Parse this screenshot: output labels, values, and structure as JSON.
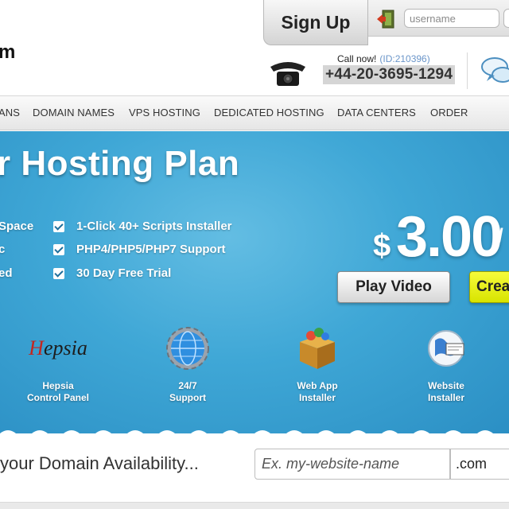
{
  "header": {
    "logo_fragment": "m",
    "signup_label": "Sign Up",
    "username_placeholder": "username",
    "call_now_label": "Call now!",
    "call_id": "(ID:210396)",
    "phone_number": "+44-20-3695-1294"
  },
  "nav": {
    "items": [
      {
        "label": "ANS"
      },
      {
        "label": "DOMAIN NAMES"
      },
      {
        "label": "VPS HOSTING"
      },
      {
        "label": "DEDICATED HOSTING"
      },
      {
        "label": "DATA CENTERS"
      },
      {
        "label": "ORDER"
      }
    ]
  },
  "hero": {
    "title": "r Hosting Plan",
    "left_features": [
      "Space",
      "c",
      "ed"
    ],
    "checked_features": [
      "1-Click 40+ Scripts Installer",
      "PHP4/PHP5/PHP7 Support",
      "30 Day Free Trial"
    ],
    "price_currency": "$",
    "price_amount": "3.00",
    "price_period": "/",
    "play_video_label": "Play Video",
    "create_label": "Create"
  },
  "features": [
    {
      "logo_text": "Hepsia",
      "label_line1": "Hepsia",
      "label_line2": "Control Panel"
    },
    {
      "label_line1": "24/7",
      "label_line2": "Support"
    },
    {
      "label_line1": "Web App",
      "label_line2": "Installer"
    },
    {
      "label_line1": "Website",
      "label_line2": "Installer"
    }
  ],
  "domain": {
    "heading": "your Domain Availability...",
    "input_placeholder": "Ex. my-website-name",
    "tld_selected": ".com"
  },
  "colors": {
    "hero_blue": "#3fa7d6",
    "create_yellow": "#e6f000",
    "call_id_blue": "#6a95c9"
  }
}
